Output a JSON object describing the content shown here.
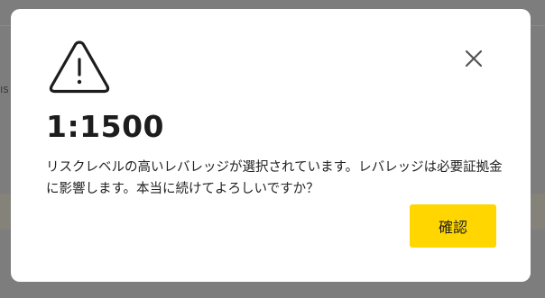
{
  "dialog": {
    "icon": "warning-triangle-icon",
    "close_icon": "close-icon",
    "leverage": "1:1500",
    "message": "リスクレベルの高いレバレッジが選択されています。レバレッジは必要証拠金\nに影響します。本当に続けてよろしいですか？",
    "confirm_label": "確認"
  },
  "background": {
    "fragment": "ıs"
  },
  "colors": {
    "accent": "#ffd600",
    "overlay": "#7d7d7d",
    "text": "#1d1d1d"
  }
}
